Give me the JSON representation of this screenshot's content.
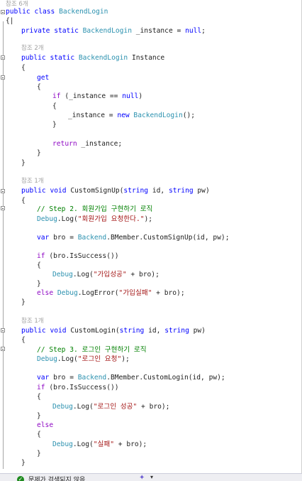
{
  "lens": {
    "class_refs": "참조 6개",
    "instance_refs": "참조 2개",
    "signup_refs": "참조 1개",
    "login_refs": "참조 1개"
  },
  "code": {
    "l1": [
      "public",
      " ",
      "class",
      " ",
      "BackendLogin"
    ],
    "l2": "{",
    "l3": [
      "private",
      " ",
      "static",
      " ",
      "BackendLogin",
      " _instance = ",
      "null",
      ";"
    ],
    "l4": [
      "public",
      " ",
      "static",
      " ",
      "BackendLogin",
      " Instance"
    ],
    "l5": "{",
    "l6": "get",
    "l7": "{",
    "l8": [
      "if",
      " (_instance == ",
      "null",
      ")"
    ],
    "l9": "{",
    "l10": [
      "_instance = ",
      "new",
      " ",
      "BackendLogin",
      "();"
    ],
    "l11": "}",
    "l12": [
      "return",
      " _instance;"
    ],
    "l13": "}",
    "l14": "}",
    "l15": [
      "public",
      " ",
      "void",
      " CustomSignUp(",
      "string",
      " id, ",
      "string",
      " pw)"
    ],
    "l16": "{",
    "l17": "// Step 2. 회원가입 구현하기 로직",
    "l18": [
      "Debug",
      ".Log(",
      "\"회원가입 요청한다.\"",
      ");"
    ],
    "l19": [
      "var",
      " bro = ",
      "Backend",
      ".BMember.CustomSignUp(id, pw);"
    ],
    "l20": [
      "if",
      " (bro.IsSuccess())"
    ],
    "l21": "{",
    "l22": [
      "Debug",
      ".Log(",
      "\"가입성공\"",
      " + bro);"
    ],
    "l23": "}",
    "l24": [
      "else",
      " ",
      "Debug",
      ".LogError(",
      "\"가입실패\"",
      " + bro);"
    ],
    "l25": "}",
    "l26": [
      "public",
      " ",
      "void",
      " CustomLogin(",
      "string",
      " id, ",
      "string",
      " pw)"
    ],
    "l27": "{",
    "l28": "// Step 3. 로그인 구현하기 로직",
    "l29": [
      "Debug",
      ".Log(",
      "\"로그인 요청\"",
      ");"
    ],
    "l30": [
      "var",
      " bro = ",
      "Backend",
      ".BMember.CustomLogin(id, pw);"
    ],
    "l31": [
      "if",
      " (bro.IsSuccess())"
    ],
    "l32": "{",
    "l33": [
      "Debug",
      ".Log(",
      "\"로그인 성공\"",
      " + bro);"
    ],
    "l34": "}",
    "l35": "else",
    "l36": "{",
    "l37": [
      "Debug",
      ".Log(",
      "\"실패\"",
      " + bro);"
    ],
    "l38": "}",
    "l39": "}"
  },
  "status": {
    "issues_text": "문제가 검색되지 않음",
    "ok_icon": "check-icon",
    "wand_icon": "magic-wand-icon"
  },
  "colors": {
    "keyword": "#0000ff",
    "type": "#2b91af",
    "comment": "#008000",
    "string": "#a31515",
    "control": "#8f08c4"
  }
}
